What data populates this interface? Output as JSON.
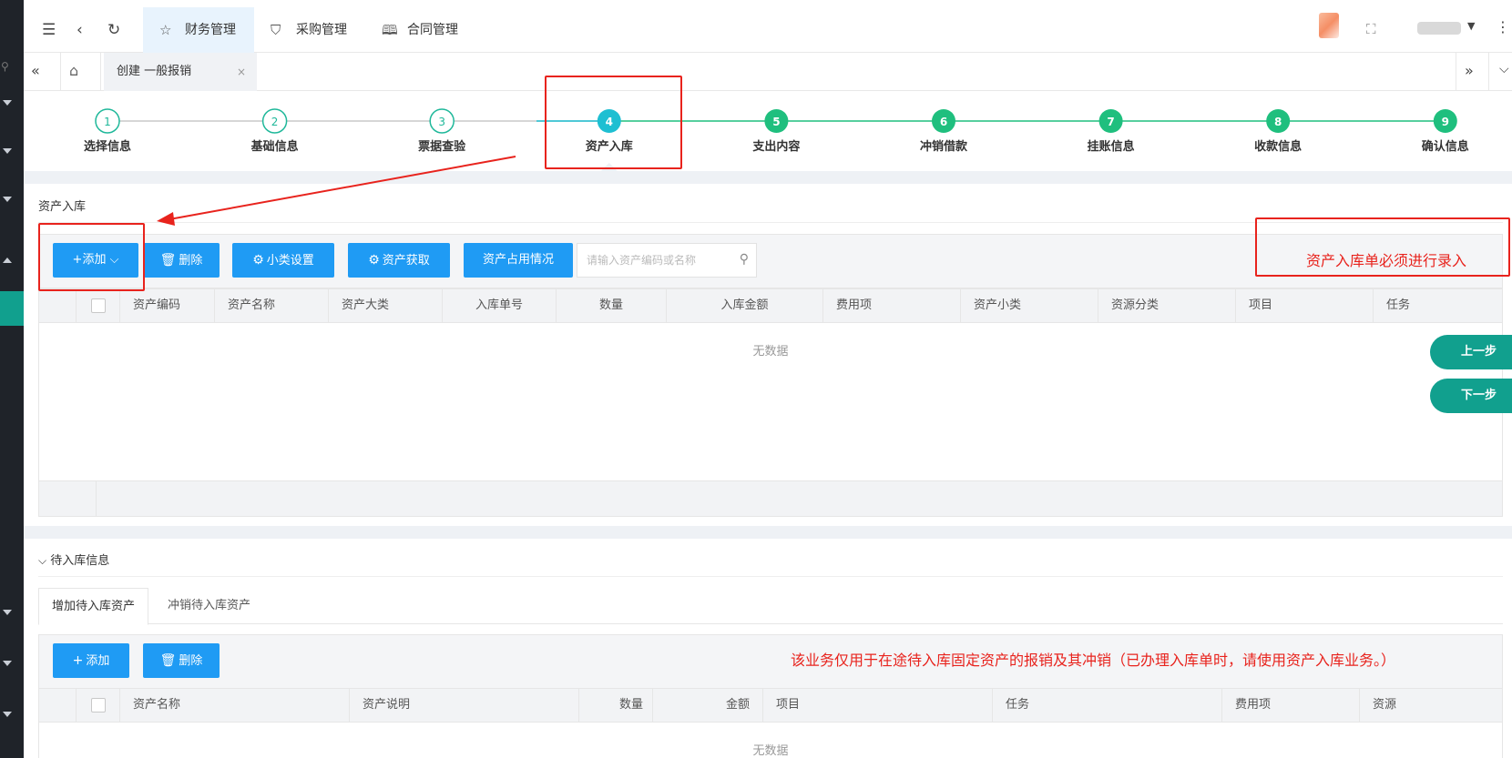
{
  "topbar": {
    "tabs": [
      {
        "label": "财务管理",
        "icon": "star-icon"
      },
      {
        "label": "采购管理",
        "icon": "shield-check-icon"
      },
      {
        "label": "合同管理",
        "icon": "book-icon"
      }
    ]
  },
  "tabbar": {
    "page_tab": "创建 一般报销",
    "close": "×"
  },
  "steps": [
    {
      "num": "1",
      "label": "选择信息",
      "state": "done"
    },
    {
      "num": "2",
      "label": "基础信息",
      "state": "done"
    },
    {
      "num": "3",
      "label": "票据查验",
      "state": "done"
    },
    {
      "num": "4",
      "label": "资产入库",
      "state": "current"
    },
    {
      "num": "5",
      "label": "支出内容",
      "state": "todo"
    },
    {
      "num": "6",
      "label": "冲销借款",
      "state": "todo"
    },
    {
      "num": "7",
      "label": "挂账信息",
      "state": "todo"
    },
    {
      "num": "8",
      "label": "收款信息",
      "state": "todo"
    },
    {
      "num": "9",
      "label": "确认信息",
      "state": "todo"
    }
  ],
  "colors": {
    "done": "#1fb89a",
    "current": "#1ebfd2",
    "todo": "#1fbf7e",
    "primary": "#1f9bf4",
    "annotation": "#e8231d",
    "side": "#11a08e"
  },
  "asset": {
    "title": "资产入库",
    "buttons": {
      "add": "+添加",
      "delete": "删除",
      "subclass": "小类设置",
      "fetch": "资产获取",
      "usage": "资产占用情况"
    },
    "search_placeholder": "请输入资产编码或名称",
    "columns": [
      "资产编码",
      "资产名称",
      "资产大类",
      "入库单号",
      "数量",
      "入库金额",
      "费用项",
      "资产小类",
      "资源分类",
      "项目",
      "任务"
    ],
    "empty": "无数据",
    "annotation": "资产入库单必须进行录入"
  },
  "nav": {
    "prev": "上一步",
    "next": "下一步"
  },
  "pending": {
    "title": "待入库信息",
    "tabs": [
      "增加待入库资产",
      "冲销待入库资产"
    ],
    "buttons": {
      "add": "添加",
      "delete": "删除"
    },
    "annotation": "该业务仅用于在途待入库固定资产的报销及其冲销（已办理入库单时，请使用资产入库业务。）",
    "columns": [
      "资产名称",
      "资产说明",
      "数量",
      "金额",
      "项目",
      "任务",
      "费用项",
      "资源"
    ],
    "empty": "无数据"
  }
}
